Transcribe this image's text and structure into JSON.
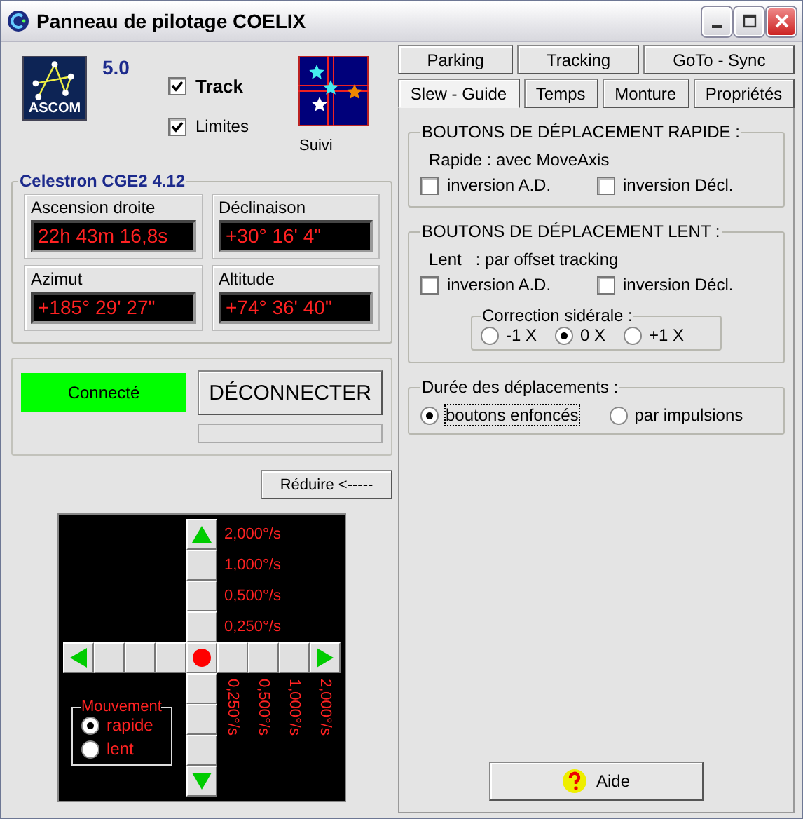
{
  "window": {
    "title": "Panneau de pilotage COELIX"
  },
  "header": {
    "logo_text": "ASCOM",
    "version": "5.0",
    "suivi_label": "Suivi",
    "checkboxes": [
      {
        "label": "Track",
        "checked": true,
        "bold": true
      },
      {
        "label": "Limites",
        "checked": true,
        "bold": false
      }
    ]
  },
  "mount": {
    "title": "Celestron CGE2 4.12",
    "fields": [
      {
        "label": "Ascension droite",
        "value": "22h 43m 16,8s"
      },
      {
        "label": "Déclinaison",
        "value": "+30° 16' 4\""
      },
      {
        "label": "Azimut",
        "value": "+185° 29' 27\""
      },
      {
        "label": "Altitude",
        "value": "+74° 36' 40\""
      }
    ]
  },
  "connection": {
    "status": "Connecté",
    "connected": true,
    "button": "DÉCONNECTER",
    "progress": {
      "level": 0
    }
  },
  "collapse_button": "Réduire <-----",
  "pad": {
    "up_speeds": [
      "2,000°/s",
      "1,000°/s",
      "0,500°/s",
      "0,250°/s"
    ],
    "down_speeds": [
      "0,250°/s",
      "0,500°/s",
      "1,000°/s",
      "2,000°/s"
    ],
    "movement": {
      "title": "Mouvement",
      "options": [
        {
          "label": "rapide",
          "selected": true
        },
        {
          "label": "lent",
          "selected": false
        }
      ]
    }
  },
  "tabs": [
    [
      {
        "label": "Parking",
        "selected": false
      },
      {
        "label": "Tracking",
        "selected": false
      },
      {
        "label": "GoTo - Sync",
        "selected": false
      }
    ],
    [
      {
        "label": "Slew - Guide",
        "selected": true
      },
      {
        "label": "Temps",
        "selected": false
      },
      {
        "label": "Monture",
        "selected": false
      },
      {
        "label": "Propriétés",
        "selected": false
      }
    ]
  ],
  "rapid": {
    "title": "BOUTONS DE DÉPLACEMENT RAPIDE :",
    "note": "Rapide : avec MoveAxis",
    "checkboxes": [
      {
        "label": "inversion A.D.",
        "checked": false
      },
      {
        "label": "inversion Décl.",
        "checked": false
      }
    ]
  },
  "slow": {
    "title": "BOUTONS DE DÉPLACEMENT LENT :",
    "note": "Lent   : par offset tracking",
    "checkboxes": [
      {
        "label": "inversion A.D.",
        "checked": false
      },
      {
        "label": "inversion Décl.",
        "checked": false
      }
    ],
    "correction": {
      "title": "Correction sidérale :",
      "options": [
        {
          "label": "-1 X",
          "selected": false
        },
        {
          "label": "0 X",
          "selected": true
        },
        {
          "label": "+1 X",
          "selected": false
        }
      ]
    }
  },
  "duration": {
    "title": "Durée des déplacements :",
    "options": [
      {
        "label": "boutons enfoncés",
        "selected": true,
        "focused": true
      },
      {
        "label": "par impulsions",
        "selected": false,
        "focused": false
      }
    ]
  },
  "help_button": "Aide"
}
